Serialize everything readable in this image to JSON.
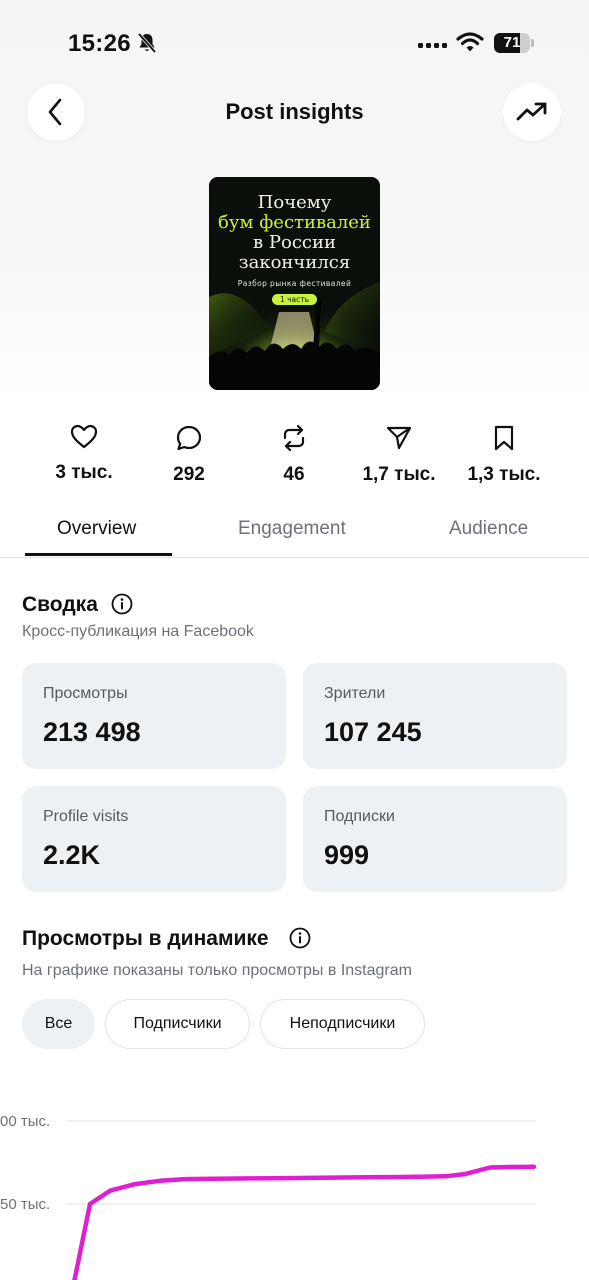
{
  "status_bar": {
    "time": "15:26",
    "battery_level": "71",
    "battery_fraction": 0.71
  },
  "header": {
    "title": "Post insights",
    "back_icon": "chevron-left-icon",
    "trend_icon": "trending-up-icon"
  },
  "poster": {
    "lines": [
      {
        "text": "Почему",
        "color": "#f1f1ea"
      },
      {
        "text": "бум фестивалей",
        "color": "#c8f23c"
      },
      {
        "text": "в России",
        "color": "#f1f1ea"
      },
      {
        "text": "закончился",
        "color": "#f1f1ea"
      }
    ],
    "subtitle": "Разбор рынка фестивалей",
    "pill": "1 часть"
  },
  "actions": [
    {
      "icon": "heart-icon",
      "count": "3 тыс."
    },
    {
      "icon": "comment-icon",
      "count": "292"
    },
    {
      "icon": "repost-icon",
      "count": "46"
    },
    {
      "icon": "send-icon",
      "count": "1,7 тыс."
    },
    {
      "icon": "bookmark-icon",
      "count": "1,3 тыс."
    }
  ],
  "tabs": [
    {
      "label": "Overview",
      "active": true
    },
    {
      "label": "Engagement",
      "active": false
    },
    {
      "label": "Audience",
      "active": false
    }
  ],
  "summary": {
    "title": "Сводка",
    "subtitle": "Кросс-публикация на Facebook",
    "cards": [
      {
        "label": "Просмотры",
        "value": "213 498"
      },
      {
        "label": "Зрители",
        "value": "107 245"
      },
      {
        "label": "Profile visits",
        "value": "2.2K"
      },
      {
        "label": "Подписки",
        "value": "999"
      }
    ]
  },
  "views_over_time": {
    "title": "Просмотры в динамике",
    "subtitle": "На графике показаны только просмотры в Instagram",
    "filters": [
      {
        "label": "Все",
        "selected": true
      },
      {
        "label": "Подписчики",
        "selected": false
      },
      {
        "label": "Неподписчики",
        "selected": false
      }
    ]
  },
  "chart_data": {
    "type": "line",
    "visible_tick_labels": [
      "00 тыс.",
      "50 тыс."
    ],
    "y_gridlines": [
      200000,
      150000
    ],
    "line_color": "#e020d0",
    "grid": true,
    "series": [
      {
        "values": [
          85000,
          150000,
          158000,
          162000,
          164000,
          165000,
          165200,
          165400,
          165600,
          165800,
          166000,
          166200,
          166400,
          166700,
          168000,
          172000,
          172300,
          172500
        ]
      }
    ]
  },
  "colors": {
    "accent_line": "#e020d0",
    "card_bg": "#eef1f4",
    "muted_text": "#6d7177"
  }
}
